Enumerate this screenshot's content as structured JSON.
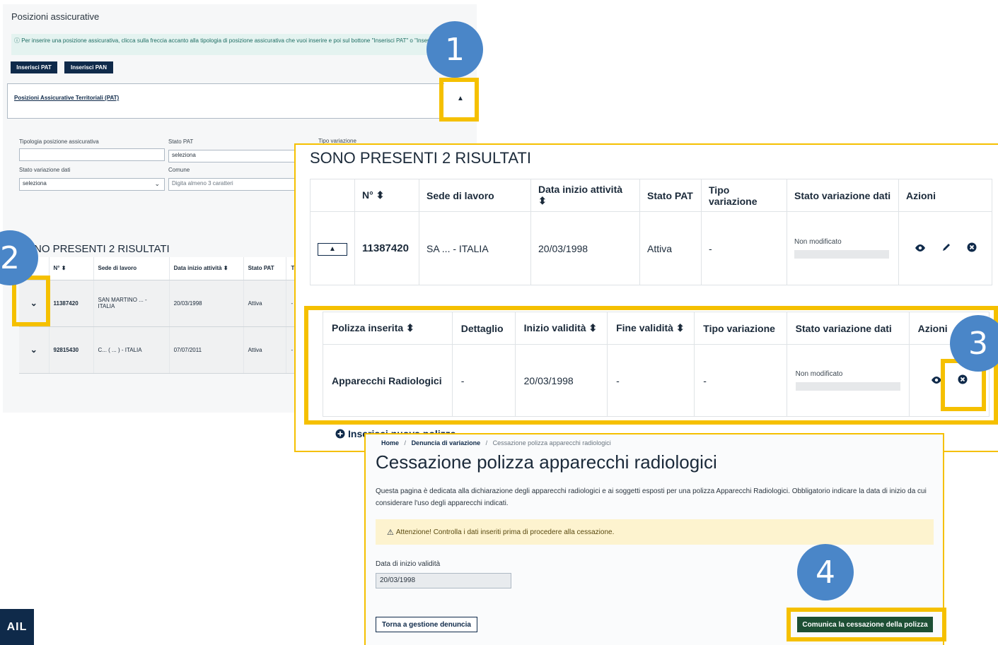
{
  "panel1": {
    "title": "Posizioni assicurative",
    "info": "ⓘ Per inserire una posizione assicurativa, clicca sulla freccia accanto alla tipologia di posizione assicurativa che vuoi inserire e poi sul bottone \"Inserisci PAT\" o \"Inserisci PAN\"",
    "buttons": [
      "Inserisci PAT",
      "Inserisci PAN"
    ],
    "accordion_label": "Posizioni Assicurative Territoriali (PAT)",
    "filters": {
      "tipologia_label": "Tipologia posizione assicurativa",
      "tipologia_value": "",
      "stato_pat_label": "Stato PAT",
      "stato_pat_value": "seleziona",
      "tipo_variazione_label": "Tipo variazione",
      "stato_variazione_label": "Stato variazione dati",
      "stato_variazione_value": "seleziona",
      "comune_label": "Comune",
      "comune_placeholder": "Digita almeno 3 caratteri"
    },
    "results_title": "NO PRESENTI 2 RISULTATI",
    "table": {
      "headers": [
        "N° ⬍",
        "Sede di lavoro",
        "Data inizio attività ⬍",
        "Stato PAT",
        "Tipo"
      ],
      "rows": [
        {
          "n": "11387420",
          "sede": "SAN MARTINO ... - ITALIA",
          "data": "20/03/1998",
          "stato": "Attiva",
          "tipo": "-"
        },
        {
          "n": "92815430",
          "sede": "C... ( ... ) - ITALIA",
          "data": "07/07/2011",
          "stato": "Attiva",
          "tipo": "-"
        }
      ]
    }
  },
  "panel2": {
    "results_title": "SONO PRESENTI 2 RISULTATI",
    "headers": [
      "N° ⬍",
      "Sede di lavoro",
      "Data inizio attività ⬍",
      "Stato PAT",
      "Tipo variazione",
      "Stato variazione dati",
      "Azioni"
    ],
    "row": {
      "n": "11387420",
      "sede": "SA ... - ITALIA",
      "data": "20/03/1998",
      "stato": "Attiva",
      "tipo": "-",
      "stato_var": "Non modificato"
    },
    "sub_headers": [
      "Polizza inserita ⬍",
      "Dettaglio",
      "Inizio validità ⬍",
      "Fine validità ⬍",
      "Tipo variazione",
      "Stato variazione dati",
      "Azioni"
    ],
    "sub_row": {
      "polizza": "Apparecchi Radiologici",
      "dettaglio": "-",
      "inizio": "20/03/1998",
      "fine": "-",
      "tipo": "-",
      "stato_var": "Non modificato"
    },
    "insert_link": "Inserisci nuova polizza"
  },
  "panel3": {
    "breadcrumb": [
      "Home",
      "Denuncia di variazione",
      "Cessazione polizza apparecchi radiologici"
    ],
    "title": "Cessazione polizza apparecchi radiologici",
    "description": "Questa pagina è dedicata alla dichiarazione degli apparecchi radiologici e ai soggetti esposti per una polizza Apparecchi Radiologici. Obbligatorio indicare la data di inizio da cui considerare l'uso degli apparecchi indicati.",
    "warning": "Attenzione! Controlla i dati inseriti prima di procedere alla cessazione.",
    "date_label": "Data di inizio validità",
    "date_value": "20/03/1998",
    "back_button": "Torna a gestione denuncia",
    "submit_button": "Comunica la cessazione della polizza"
  },
  "badges": [
    "1",
    "2",
    "3",
    "4"
  ],
  "logo": "AIL",
  "colors": {
    "highlight": "#f5c000",
    "badge": "#4a86c8",
    "navy": "#0f2a4a",
    "green": "#1d4f34"
  }
}
